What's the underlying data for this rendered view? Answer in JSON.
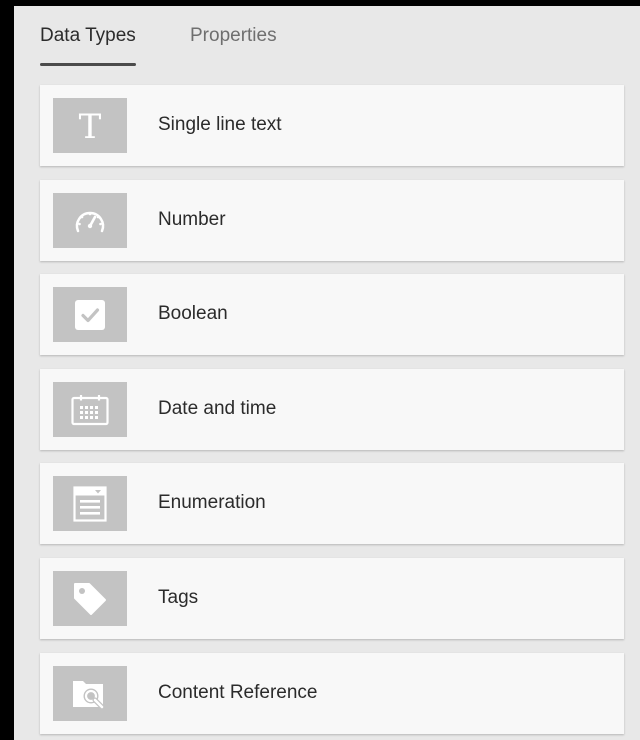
{
  "tabs": [
    {
      "label": "Data Types",
      "active": true
    },
    {
      "label": "Properties",
      "active": false
    }
  ],
  "data_types": [
    {
      "label": "Single line text",
      "icon": "text-t-icon"
    },
    {
      "label": "Number",
      "icon": "speedometer-icon"
    },
    {
      "label": "Boolean",
      "icon": "checkbox-icon"
    },
    {
      "label": "Date and time",
      "icon": "calendar-icon"
    },
    {
      "label": "Enumeration",
      "icon": "dropdown-list-icon"
    },
    {
      "label": "Tags",
      "icon": "tag-icon"
    },
    {
      "label": "Content Reference",
      "icon": "folder-search-icon"
    }
  ],
  "colors": {
    "panel_bg": "#e8e8e8",
    "card_bg": "#f8f8f8",
    "icon_tile_bg": "#c3c3c3",
    "icon_fg": "#ffffff",
    "tab_active_text": "#2c2c2c",
    "tab_inactive_text": "#6f6f6f",
    "tab_underline": "#4b4b4b"
  }
}
